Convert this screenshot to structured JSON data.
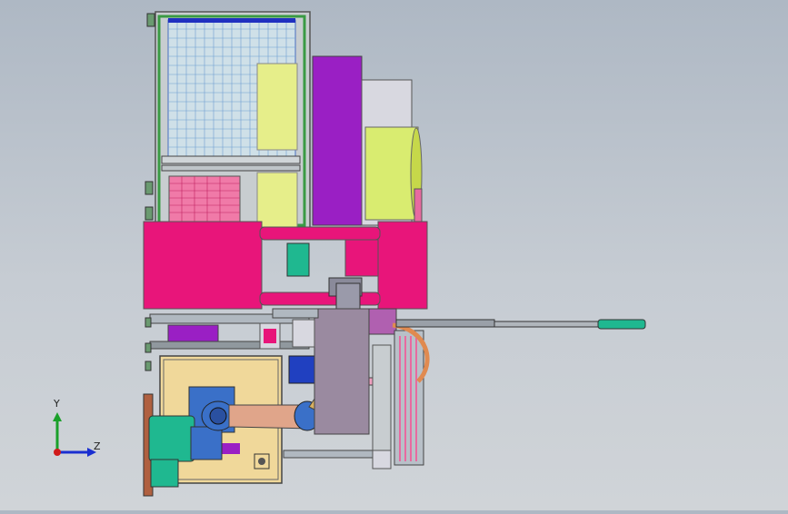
{
  "viewport": {
    "background_top": "#aeb8c4",
    "background_bottom": "#d0d4d8"
  },
  "triad": {
    "y_label": "Y",
    "z_label": "Z",
    "y_color": "#1aa02a",
    "z_color": "#1a2fd0",
    "x_color": "#d01a1a"
  },
  "model": {
    "colors": {
      "magenta": "#e8157a",
      "purple": "#9a1fc4",
      "yellow_green": "#d9ec70",
      "teal": "#1fb890",
      "robot_blue": "#3a70c8",
      "robot_tan": "#e0a58a",
      "tan_panel": "#f0d89a",
      "frame_gray": "#7a8088",
      "green_frame": "#4aa050",
      "orange_pipe": "#e08a50",
      "pink_rail": "#e86aa0"
    }
  }
}
